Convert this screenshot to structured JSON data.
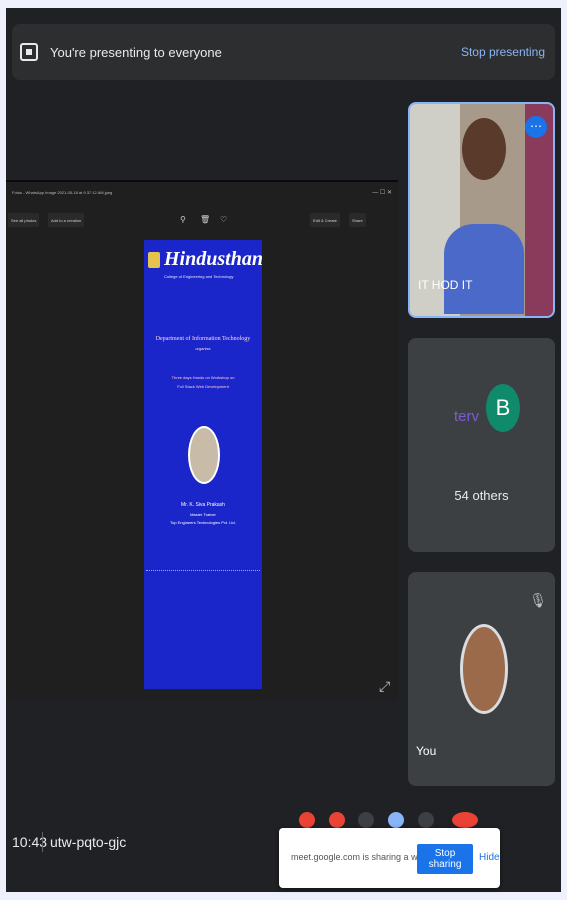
{
  "banner": {
    "text": "You're presenting to everyone",
    "stop_label": "Stop presenting"
  },
  "shared_window": {
    "app_title": "Fotos - WhatsApp Image 2021-05-18 at 9.37.12 AM.jpeg",
    "window_controls": "— ☐ ✕",
    "toolbar": {
      "see_all_photos": "See all photos",
      "add_to_creation": "Add to a creation",
      "edit_create": "Edit & Create",
      "share": "Share"
    },
    "poster": {
      "college_name": "Hindusthan",
      "college_sub": "College of Engineering and Technology",
      "department": "Department of Information Technology",
      "organise": "organise",
      "line1": "Three days Hands on Workshop on",
      "line2": "Full Stack Web Development",
      "speaker": "Mr. K. Siva Prakash",
      "role": "Master Trainer",
      "org": "Top Engineers Technologies Pvt. Ltd."
    }
  },
  "participants": [
    {
      "name": "IT HOD IT",
      "more_icon": "more-vert-icon"
    },
    {
      "logo_text": "terv",
      "avatar_letter": "B",
      "others_text": "54 others"
    },
    {
      "name": "You",
      "mic_icon": "mic-off-icon"
    }
  ],
  "footer": {
    "time": "10:43",
    "meeting_code": "utw-pqto-gjc"
  },
  "share_popup": {
    "text": "meet.google.com is sharing a window.",
    "stop_sharing_label": "Stop sharing",
    "hide_label": "Hide"
  },
  "colors": {
    "background": "#202124",
    "tile": "#3c4043",
    "accent": "#8ab4f8",
    "button_blue": "#1a73e8",
    "poster_blue": "#1a26c9"
  }
}
